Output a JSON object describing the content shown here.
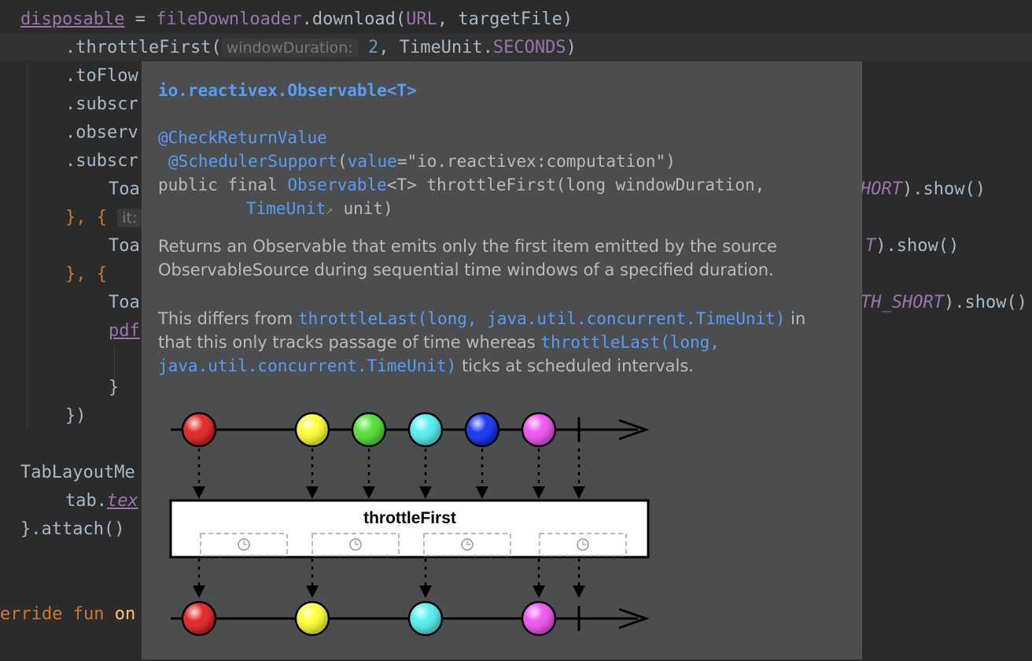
{
  "editor": {
    "line1": {
      "var": "disposable",
      "eq": " = ",
      "obj": "fileDownloader",
      "dot": ".",
      "method": "download",
      "args_open": "(",
      "arg1": "URL",
      "comma": ", ",
      "arg2": "targetFile",
      "close": ")"
    },
    "line2": {
      "method": ".throttleFirst(",
      "hint": "windowDuration:",
      "num": "2",
      "sep": ", ",
      "unit_cls": "TimeUnit.",
      "unit_const": "SECONDS",
      "close": ")"
    },
    "line3": ".toFlow",
    "line4": ".subscr",
    "line5": ".observ",
    "line6": ".subscr",
    "line7": {
      "left": "Toa",
      "right_const": "HORT",
      "right_tail": ").show()"
    },
    "line8": {
      "left": "}, {",
      "hint": "it:"
    },
    "line9": {
      "left": "Toa",
      "right_const": "T",
      "right_tail": ").show()"
    },
    "line10": "}, {",
    "line11": {
      "left": "Toa",
      "right_const": "TH_SHORT",
      "right_tail": ").show()"
    },
    "line12": "pdf",
    "line13": "}",
    "line14": "})",
    "line15": "TabLayoutMe",
    "line16": {
      "left": "tab.",
      "prop": "tex"
    },
    "line17": "}.attach()",
    "line18": {
      "kw": "erride fun ",
      "fn": "on"
    }
  },
  "popup": {
    "header": "io.reactivex.Observable<T>",
    "annotation1": "@CheckReturnValue",
    "annotation2": {
      "name": "@SchedulerSupport",
      "open": "(",
      "param": "value",
      "eq": "=",
      "str": "\"io.reactivex:computation\"",
      "close": ")"
    },
    "signature1": {
      "pre": "public final ",
      "type": "Observable",
      "gen": "<T>",
      "rest": " throttleFirst(long windowDuration,"
    },
    "signature2": {
      "type": "TimeUnit",
      "ext": "↗",
      "rest": " unit)"
    },
    "desc1": "Returns an Observable that emits only the first item emitted by the source ObservableSource during sequential time windows of a specified duration.",
    "desc2": {
      "p1": "This differs from ",
      "link1": "throttleLast(long, java.util.concurrent.TimeUnit)",
      "p2": " in that this only tracks passage of time whereas ",
      "link2": "throttleLast(long, java.util.concurrent.TimeUnit)",
      "p3": " ticks at scheduled intervals."
    },
    "diagram": {
      "operator_label": "throttleFirst",
      "input_colors": [
        "#e02020",
        "#ffff30",
        "#50e030",
        "#50f0f0",
        "#1030f0",
        "#f050f0"
      ],
      "output_colors": [
        "#e02020",
        "#ffff30",
        "#50f0f0",
        "#f050f0"
      ]
    }
  }
}
